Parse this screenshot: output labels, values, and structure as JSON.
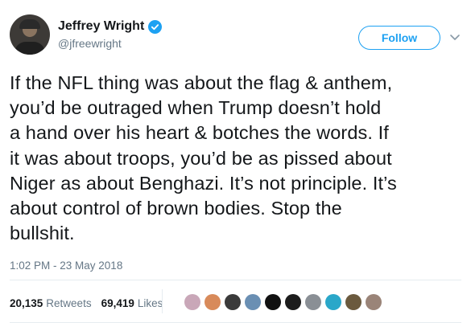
{
  "author": {
    "display_name": "Jeffrey Wright",
    "handle": "@jfreewright",
    "verified_color": "#1da1f2"
  },
  "follow_label": "Follow",
  "tweet_lines": [
    "If the NFL thing was about the flag & anthem,",
    "you’d be outraged when Trump doesn’t hold",
    "a hand over his heart & botches the words. If",
    "it was about troops, you’d be as pissed about",
    "Niger as about Benghazi. It’s not principle. It’s",
    "about control of brown bodies. Stop the",
    "bullshit."
  ],
  "timestamp": "1:02 PM - 23 May 2018",
  "stats": {
    "retweets_count": "20,135",
    "retweets_label": "Retweets",
    "likes_count": "69,419",
    "likes_label": "Likes"
  },
  "liker_avatars": [
    {
      "name": "liker-avatar-1",
      "color": "#c9a7b8"
    },
    {
      "name": "liker-avatar-2",
      "color": "#d88a5a"
    },
    {
      "name": "liker-avatar-3",
      "color": "#3a3a3a"
    },
    {
      "name": "liker-avatar-4",
      "color": "#6a8fb3"
    },
    {
      "name": "liker-avatar-5",
      "color": "#111111"
    },
    {
      "name": "liker-avatar-6",
      "color": "#1c1c1c"
    },
    {
      "name": "liker-avatar-7",
      "color": "#8a8f95"
    },
    {
      "name": "liker-avatar-8",
      "color": "#2aa7c9"
    },
    {
      "name": "liker-avatar-9",
      "color": "#6b5a3e"
    },
    {
      "name": "liker-avatar-10",
      "color": "#9a8478"
    }
  ]
}
